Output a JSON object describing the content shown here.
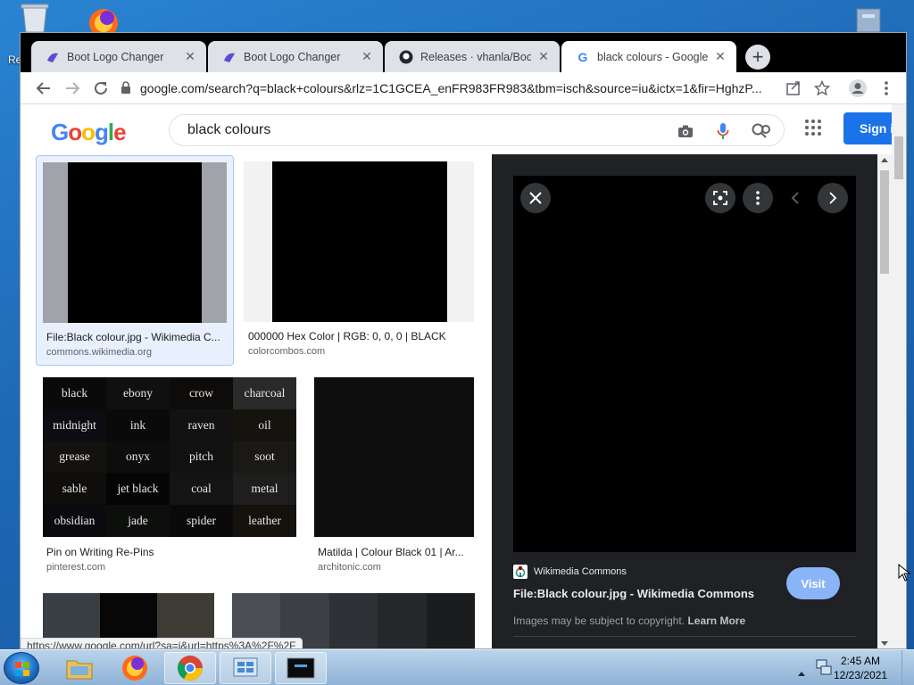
{
  "desktop": {
    "partial_label": "Re"
  },
  "browser": {
    "tabs": [
      {
        "title": "Boot Logo Changer",
        "icon": "bootlogo-icon",
        "active": false
      },
      {
        "title": "Boot Logo Changer",
        "icon": "bootlogo-icon",
        "active": false
      },
      {
        "title": "Releases · vhanla/BootLo",
        "icon": "github-icon",
        "active": false
      },
      {
        "title": "black colours - Google S",
        "icon": "google-icon",
        "active": true
      }
    ],
    "new_tab_label": "+",
    "url": "google.com/search?q=black+colours&rlz=1C1GCEA_enFR983FR983&tbm=isch&source=iu&ictx=1&fir=HghzP...",
    "status_url": "https://www.google.com/url?sa=i&url=https%3A%2F%2F"
  },
  "google": {
    "logo_letters": [
      "G",
      "o",
      "o",
      "g",
      "l",
      "e"
    ],
    "logo_colors": [
      "#4285f4",
      "#ea4335",
      "#fbbc05",
      "#4285f4",
      "#34a853",
      "#ea4335"
    ],
    "search_query": "black colours",
    "signin_label": "Sign i"
  },
  "results": [
    {
      "title": "File:Black colour.jpg - Wikimedia C...",
      "site": "commons.wikimedia.org"
    },
    {
      "title": "000000 Hex Color | RGB: 0, 0, 0 | BLACK",
      "site": "colorcombos.com"
    },
    {
      "title": "Pin on Writing Re-Pins",
      "site": "pinterest.com"
    },
    {
      "title": "Matilda | Colour Black 01 | Ar...",
      "site": "architonic.com"
    }
  ],
  "word_grid": [
    "black",
    "ebony",
    "crow",
    "charcoal",
    "midnight",
    "ink",
    "raven",
    "oil",
    "grease",
    "onyx",
    "pitch",
    "soot",
    "sable",
    "jet black",
    "coal",
    "metal",
    "obsidian",
    "jade",
    "spider",
    "leather"
  ],
  "preview": {
    "source": "Wikimedia Commons",
    "title": "File:Black colour.jpg - Wikimedia Commons",
    "visit_label": "Visit",
    "copyright_text": "Images may be subject to copyright.",
    "learn_more": "Learn More"
  },
  "taskbar": {
    "time": "2:45 AM",
    "date": "12/23/2021"
  }
}
